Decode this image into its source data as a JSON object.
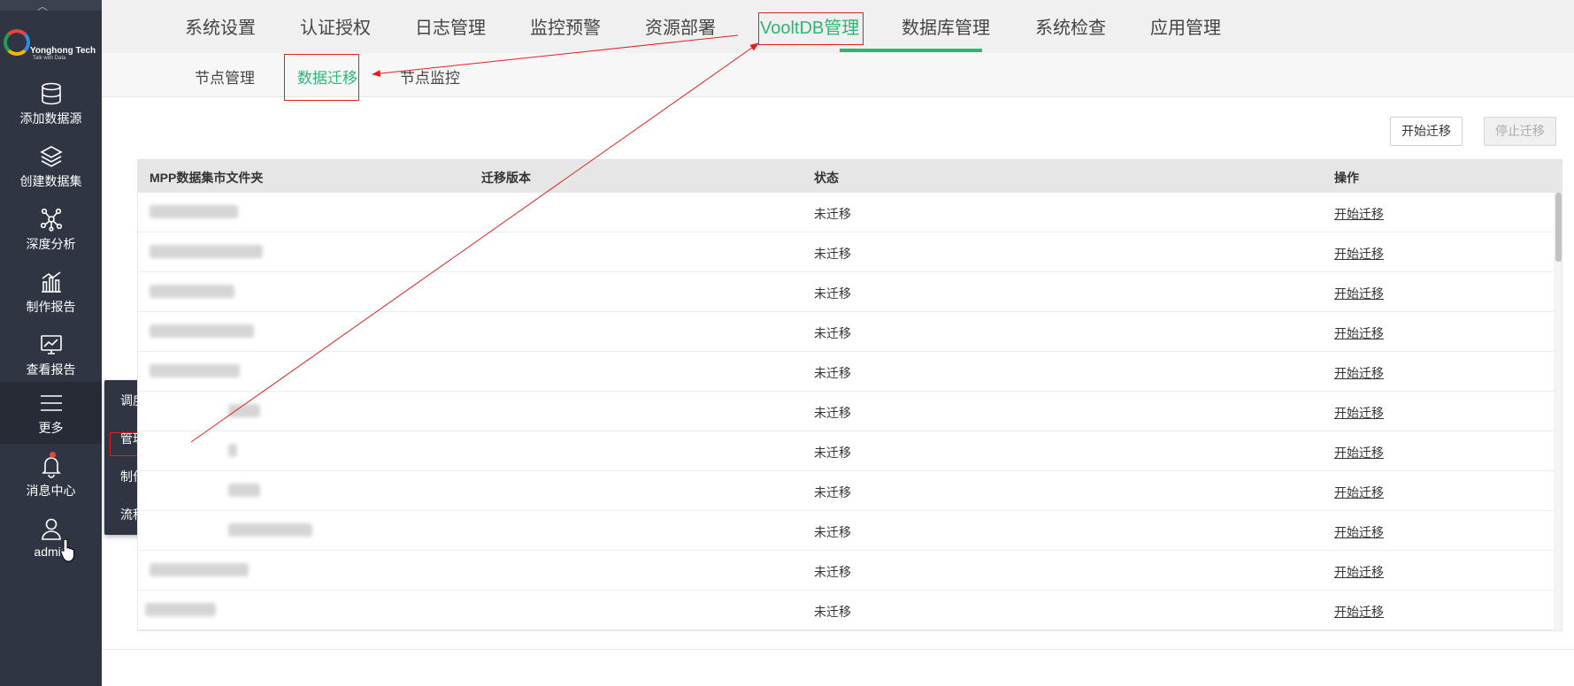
{
  "sidebar": {
    "logo": {
      "brand": "Yonghong Tech",
      "tagline": "Talk with Data"
    },
    "items": [
      {
        "label": "添加数据源",
        "icon": "database-icon"
      },
      {
        "label": "创建数据集",
        "icon": "layers-icon"
      },
      {
        "label": "深度分析",
        "icon": "network-icon"
      },
      {
        "label": "制作报告",
        "icon": "bar-chart-icon"
      },
      {
        "label": "查看报告",
        "icon": "monitor-chart-icon"
      },
      {
        "label": "更多",
        "icon": "menu-icon"
      },
      {
        "label": "消息中心",
        "icon": "bell-icon"
      },
      {
        "label": "admin",
        "icon": "user-icon"
      }
    ]
  },
  "popup_menu": {
    "items": [
      {
        "label": "调度任务"
      },
      {
        "label": "管理系统"
      },
      {
        "label": "制作门户"
      },
      {
        "label": "流程审批"
      }
    ]
  },
  "top_tabs": [
    {
      "label": "系统设置"
    },
    {
      "label": "认证授权"
    },
    {
      "label": "日志管理"
    },
    {
      "label": "监控预警"
    },
    {
      "label": "资源部署"
    },
    {
      "label": "VooltDB管理"
    },
    {
      "label": "数据库管理"
    },
    {
      "label": "系统检查"
    },
    {
      "label": "应用管理"
    }
  ],
  "sub_tabs": [
    {
      "label": "节点管理"
    },
    {
      "label": "数据迁移"
    },
    {
      "label": "节点监控"
    }
  ],
  "actions": {
    "start": "开始迁移",
    "stop": "停止迁移"
  },
  "table": {
    "columns": [
      "MPP数据集市文件夹",
      "迁移版本",
      "状态",
      "操作"
    ],
    "rows": [
      {
        "status": "未迁移",
        "action": "开始迁移"
      },
      {
        "status": "未迁移",
        "action": "开始迁移"
      },
      {
        "status": "未迁移",
        "action": "开始迁移"
      },
      {
        "status": "未迁移",
        "action": "开始迁移"
      },
      {
        "status": "未迁移",
        "action": "开始迁移"
      },
      {
        "status": "未迁移",
        "action": "开始迁移"
      },
      {
        "status": "未迁移",
        "action": "开始迁移"
      },
      {
        "status": "未迁移",
        "action": "开始迁移"
      },
      {
        "status": "未迁移",
        "action": "开始迁移"
      },
      {
        "status": "未迁移",
        "action": "开始迁移"
      },
      {
        "status": "未迁移",
        "action": "开始迁移"
      }
    ]
  },
  "colors": {
    "accent": "#2eb574",
    "sidebar": "#2f3542",
    "annotation": "#e02020"
  }
}
